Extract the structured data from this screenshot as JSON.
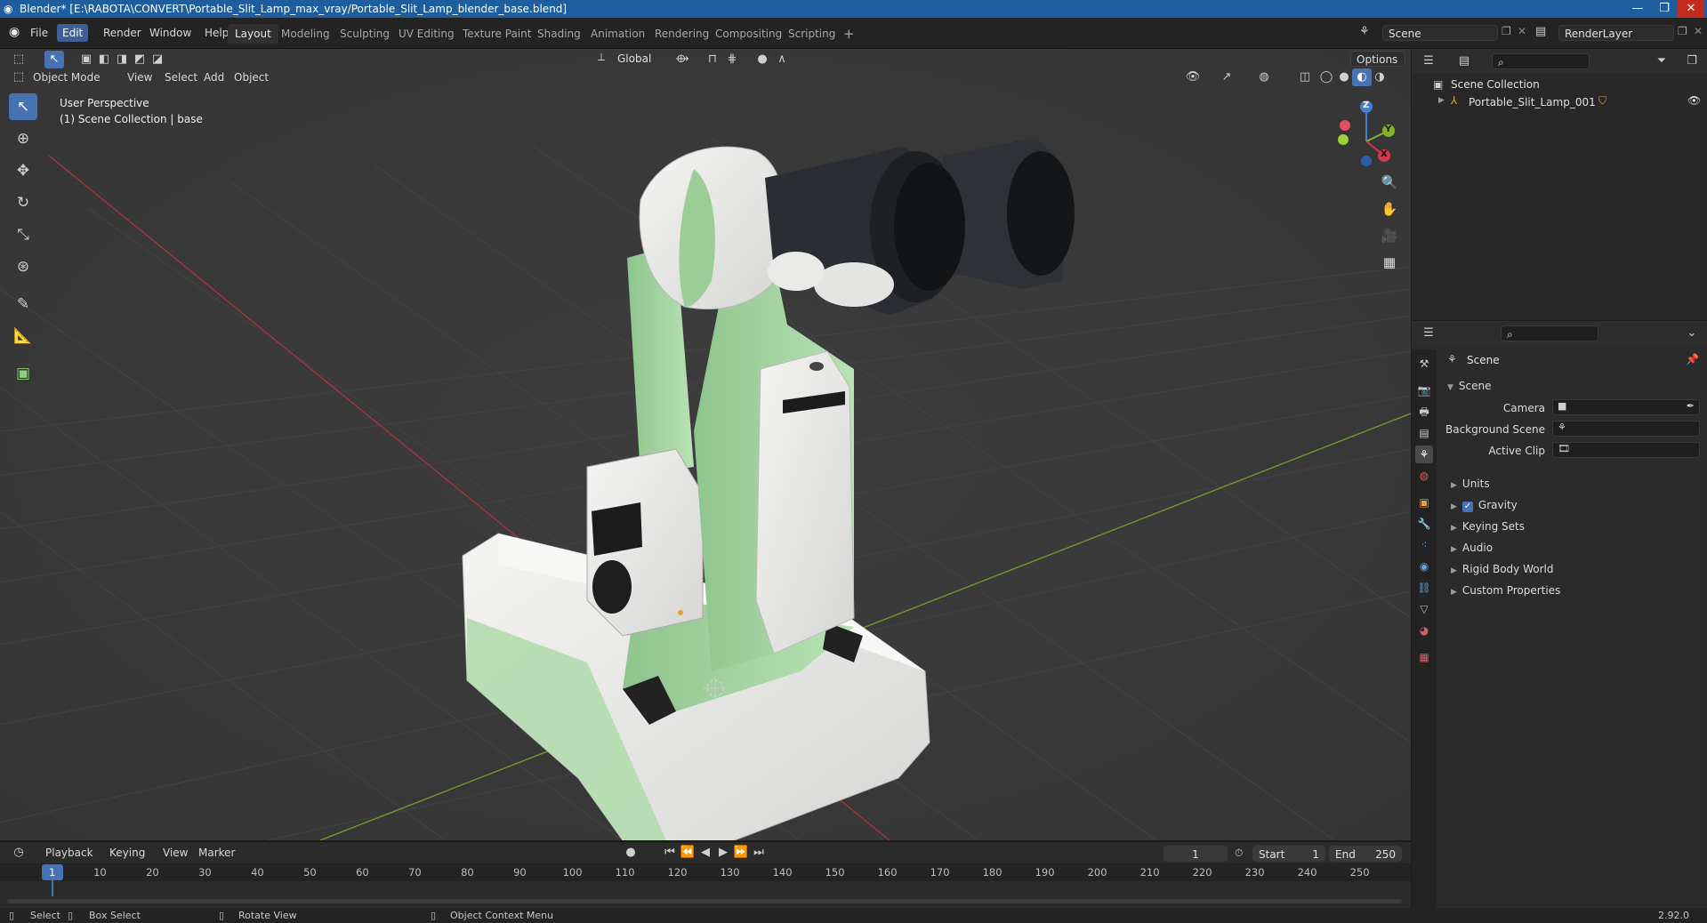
{
  "window": {
    "title": "Blender* [E:\\RABOTA\\CONVERT\\Portable_Slit_Lamp_max_vray/Portable_Slit_Lamp_blender_base.blend]",
    "controls": [
      "—",
      "❐",
      "✕"
    ]
  },
  "menubar": {
    "items": [
      "File",
      "Edit",
      "Render",
      "Window",
      "Help"
    ],
    "active_item": "Edit",
    "workspaces": [
      "Layout",
      "Modeling",
      "Sculpting",
      "UV Editing",
      "Texture Paint",
      "Shading",
      "Animation",
      "Rendering",
      "Compositing",
      "Scripting"
    ],
    "active_workspace": "Layout",
    "add_tab": "+",
    "scene": "Scene",
    "view_layer": "RenderLayer"
  },
  "viewport": {
    "mode": "Object Mode",
    "menus": [
      "View",
      "Select",
      "Add",
      "Object"
    ],
    "transform_orientation": "Global",
    "options_label": "Options",
    "overlay_line1": "User Perspective",
    "overlay_line2": "(1) Scene Collection | base",
    "gizmo": {
      "z": "Z",
      "y": "Y",
      "x": "X"
    }
  },
  "outliner": {
    "root": "Scene Collection",
    "items": [
      {
        "label": "Portable_Slit_Lamp_001"
      }
    ]
  },
  "properties": {
    "context_title": "Scene",
    "panel_title": "Scene",
    "fields": [
      {
        "label": "Camera",
        "value": ""
      },
      {
        "label": "Background Scene",
        "value": ""
      },
      {
        "label": "Active Clip",
        "value": ""
      }
    ],
    "sections": [
      "Units",
      "Gravity",
      "Keying Sets",
      "Audio",
      "Rigid Body World",
      "Custom Properties"
    ],
    "gravity_checked": true
  },
  "timeline": {
    "menus": [
      "Playback",
      "Keying",
      "View",
      "Marker"
    ],
    "current_frame": "1",
    "start_label": "Start",
    "start": "1",
    "end_label": "End",
    "end": "250",
    "ticks": [
      "1",
      "10",
      "20",
      "30",
      "40",
      "50",
      "60",
      "70",
      "80",
      "90",
      "100",
      "110",
      "120",
      "130",
      "140",
      "150",
      "160",
      "170",
      "180",
      "190",
      "200",
      "210",
      "220",
      "230",
      "240",
      "250"
    ]
  },
  "statusbar": {
    "items": [
      "Select",
      "Box Select",
      "Rotate View",
      "Object Context Menu"
    ],
    "version": "2.92.0"
  },
  "colors": {
    "accent": "#4772b3",
    "titlebar": "#1f5e9e",
    "viewport_bg": "#393939",
    "device_green": "#a9dba6",
    "device_white": "#ededeb",
    "x_axis": "#d0394f",
    "y_axis": "#82b32b"
  }
}
